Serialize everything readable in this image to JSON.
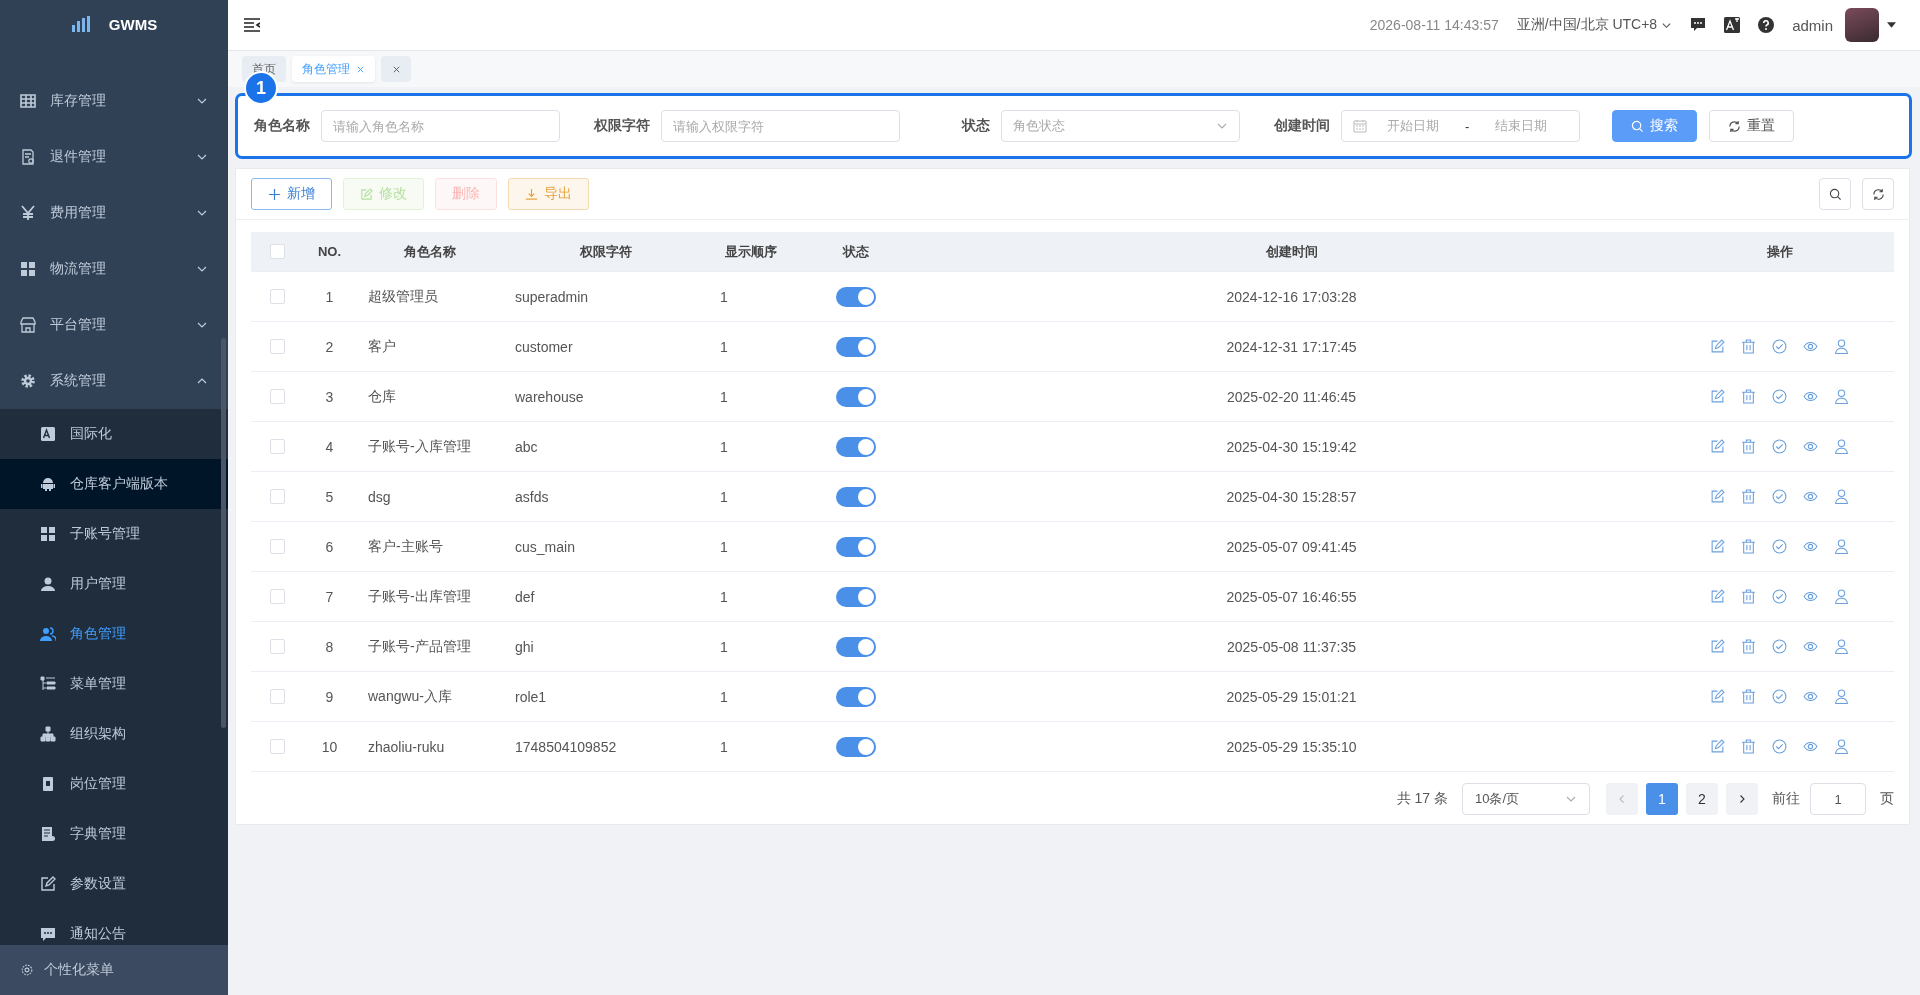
{
  "sidebar": {
    "logo": "GWMS",
    "groups": [
      {
        "label": "库存管理",
        "expanded": false
      },
      {
        "label": "退件管理",
        "expanded": false
      },
      {
        "label": "费用管理",
        "expanded": false
      },
      {
        "label": "物流管理",
        "expanded": false
      },
      {
        "label": "平台管理",
        "expanded": false
      },
      {
        "label": "系统管理",
        "expanded": true,
        "children": [
          {
            "label": "国际化",
            "selected": false,
            "hovered": false
          },
          {
            "label": "仓库客户端版本",
            "selected": false,
            "hovered": true
          },
          {
            "label": "子账号管理",
            "selected": false,
            "hovered": false
          },
          {
            "label": "用户管理",
            "selected": false,
            "hovered": false
          },
          {
            "label": "角色管理",
            "selected": true,
            "hovered": false
          },
          {
            "label": "菜单管理",
            "selected": false,
            "hovered": false
          },
          {
            "label": "组织架构",
            "selected": false,
            "hovered": false
          },
          {
            "label": "岗位管理",
            "selected": false,
            "hovered": false
          },
          {
            "label": "字典管理",
            "selected": false,
            "hovered": false
          },
          {
            "label": "参数设置",
            "selected": false,
            "hovered": false
          },
          {
            "label": "通知公告",
            "selected": false,
            "hovered": false
          }
        ]
      }
    ],
    "footer": "个性化菜单"
  },
  "header": {
    "datetime": "2026-08-11 14:43:57",
    "timezone": "亚洲/中国/北京 UTC+8",
    "user": "admin"
  },
  "tabs": [
    {
      "label": "首页",
      "selected": false,
      "closable": false
    },
    {
      "label": "角色管理",
      "selected": true,
      "closable": true
    }
  ],
  "annotation": {
    "badge": "1"
  },
  "search_form": {
    "fields": [
      {
        "kind": "input",
        "label": "角色名称",
        "placeholder": "请输入角色名称"
      },
      {
        "kind": "input",
        "label": "权限字符",
        "placeholder": "请输入权限字符"
      },
      {
        "kind": "select",
        "label": "状态",
        "placeholder": "角色状态"
      },
      {
        "kind": "daterange",
        "label": "创建时间",
        "start_placeholder": "开始日期",
        "separator": "-",
        "end_placeholder": "结束日期"
      }
    ],
    "buttons": [
      {
        "kind": "primary",
        "label": "搜索"
      },
      {
        "kind": "default",
        "label": "重置"
      }
    ]
  },
  "toolbar": [
    {
      "kind": "add",
      "label": "新增",
      "disabled": false
    },
    {
      "kind": "edit",
      "label": "修改",
      "disabled": true
    },
    {
      "kind": "delete",
      "label": "删除",
      "disabled": true
    },
    {
      "kind": "export",
      "label": "导出",
      "disabled": false
    }
  ],
  "table": {
    "all_checked": false,
    "columns": [
      "NO.",
      "角色名称",
      "权限字符",
      "显示顺序",
      "状态",
      "创建时间",
      "操作"
    ],
    "rows": [
      {
        "no": "1",
        "name": "超级管理员",
        "key": "superadmin",
        "order": "1",
        "on": true,
        "created": "2024-12-16 17:03:28",
        "actions": false,
        "checked": false
      },
      {
        "no": "2",
        "name": "客户",
        "key": "customer",
        "order": "1",
        "on": true,
        "created": "2024-12-31 17:17:45",
        "actions": true,
        "checked": false
      },
      {
        "no": "3",
        "name": "仓库",
        "key": "warehouse",
        "order": "1",
        "on": true,
        "created": "2025-02-20 11:46:45",
        "actions": true,
        "checked": false
      },
      {
        "no": "4",
        "name": "子账号-入库管理",
        "key": "abc",
        "order": "1",
        "on": true,
        "created": "2025-04-30 15:19:42",
        "actions": true,
        "checked": false
      },
      {
        "no": "5",
        "name": "dsg",
        "key": "asfds",
        "order": "1",
        "on": true,
        "created": "2025-04-30 15:28:57",
        "actions": true,
        "checked": false
      },
      {
        "no": "6",
        "name": "客户-主账号",
        "key": "cus_main",
        "order": "1",
        "on": true,
        "created": "2025-05-07 09:41:45",
        "actions": true,
        "checked": false
      },
      {
        "no": "7",
        "name": "子账号-出库管理",
        "key": "def",
        "order": "1",
        "on": true,
        "created": "2025-05-07 16:46:55",
        "actions": true,
        "checked": false
      },
      {
        "no": "8",
        "name": "子账号-产品管理",
        "key": "ghi",
        "order": "1",
        "on": true,
        "created": "2025-05-08 11:37:35",
        "actions": true,
        "checked": false
      },
      {
        "no": "9",
        "name": "wangwu-入库",
        "key": "role1",
        "order": "1",
        "on": true,
        "created": "2025-05-29 15:01:21",
        "actions": true,
        "checked": false
      },
      {
        "no": "10",
        "name": "zhaoliu-ruku",
        "key": "1748504109852",
        "order": "1",
        "on": true,
        "created": "2025-05-29 15:35:10",
        "actions": true,
        "checked": false
      }
    ]
  },
  "pagination": {
    "total": "共 17 条",
    "page_size": "10条/页",
    "pages": [
      {
        "label": "1",
        "selected": true
      },
      {
        "label": "2",
        "selected": false
      }
    ],
    "goto_label": "前往",
    "goto_value": "1",
    "page_suffix": "页"
  }
}
